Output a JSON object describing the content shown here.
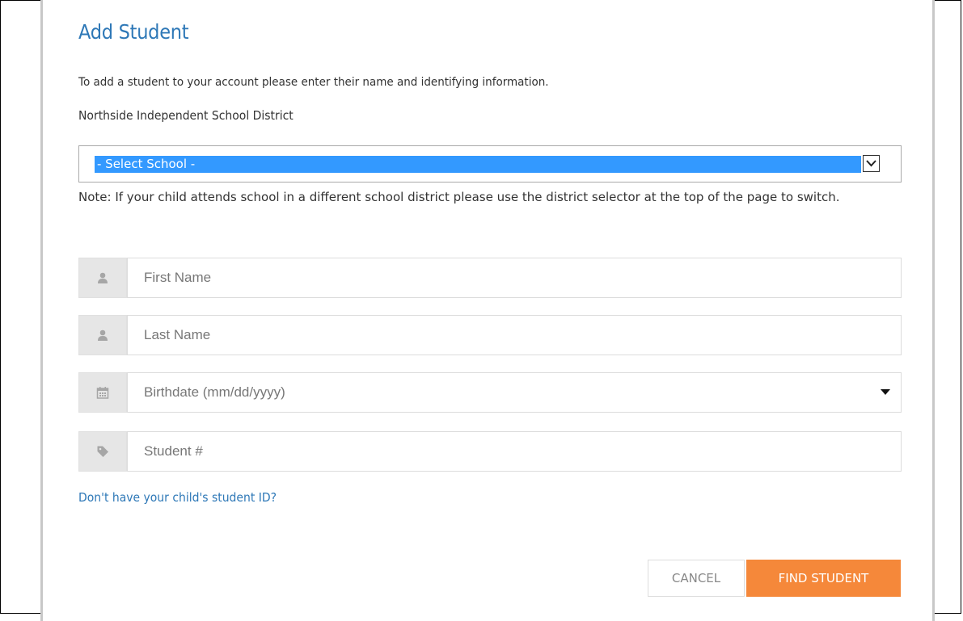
{
  "dialog": {
    "title": "Add Student",
    "intro": "To add a student to your account please enter their name and identifying information.",
    "district": "Northside Independent School District",
    "school_select": {
      "selected": "- Select School -"
    },
    "note": "Note: If your child attends school in a different school district please use the district selector at the top of the page to switch.",
    "fields": {
      "first_name": {
        "placeholder": "First Name",
        "icon": "user-icon"
      },
      "last_name": {
        "placeholder": "Last Name",
        "icon": "user-icon"
      },
      "birthdate": {
        "placeholder": "Birthdate (mm/dd/yyyy)",
        "icon": "calendar-icon"
      },
      "student_number": {
        "placeholder": "Student #",
        "icon": "tag-icon"
      }
    },
    "help_link": "Don't have your child's student ID?",
    "buttons": {
      "cancel": "CANCEL",
      "find": "FIND STUDENT"
    }
  },
  "colors": {
    "title": "#2e78b7",
    "link": "#2e78b7",
    "select_highlight": "#3399ff",
    "primary_button": "#f5883a",
    "addon_bg": "#e6e6e6"
  }
}
